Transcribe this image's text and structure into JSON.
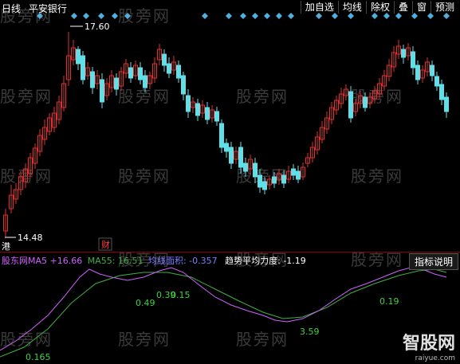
{
  "header": {
    "period": "日线",
    "stock_name": "平安银行"
  },
  "menu": [
    {
      "label": "加自选"
    },
    {
      "label": "均线"
    },
    {
      "label": "除权"
    },
    {
      "label": "叠"
    },
    {
      "label": "窗"
    },
    {
      "label": "预测"
    }
  ],
  "price": {
    "high_label": "17.60",
    "low_label": "14.48",
    "marker_gang": "港",
    "marker_cai": "财"
  },
  "indicator": {
    "legend_name": "股东网MA5",
    "ma5": "+16.66",
    "ma55": "MA55: 16.51",
    "area": "均线面积: -0.357",
    "trend": "趋势平均力度: -1.19",
    "button": "指标说明",
    "annotations": [
      "0.165",
      "0.49",
      "0.39",
      "0.15",
      "3.59",
      "0.19"
    ]
  },
  "watermark": "股旁网",
  "logo": {
    "name": "智股网",
    "url": "raiyue.com"
  },
  "colors": {
    "up": "#e03030",
    "down": "#5fe0e8",
    "ma5": "#d060ff",
    "ma55": "#40b040",
    "diamond": "#4fb0e0"
  }
}
